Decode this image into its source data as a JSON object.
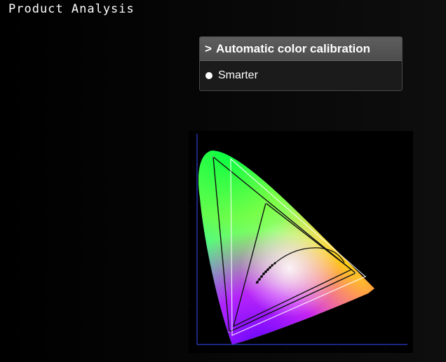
{
  "page": {
    "title": "Product Analysis"
  },
  "calibration_panel": {
    "header_chevron": ">",
    "header_label": "Automatic color calibration",
    "option_label": "Smarter",
    "option_selected": true
  },
  "cie_diagram": {
    "icon": "cie-chromaticity-diagram-icon",
    "colors": {
      "background": "#000000",
      "axis": "#2233aa",
      "triangle_white": "#ffffff",
      "triangle_dark": "#111111"
    }
  }
}
